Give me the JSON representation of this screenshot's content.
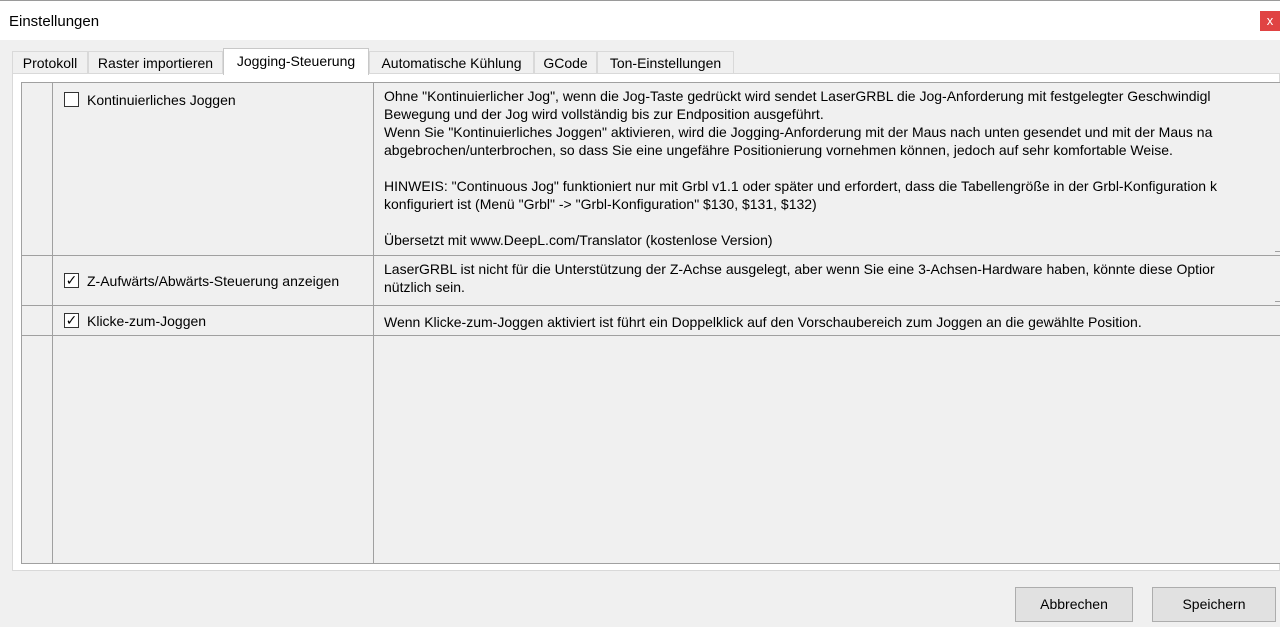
{
  "window": {
    "title": "Einstellungen",
    "close_glyph": "x"
  },
  "tabs": [
    {
      "label": "Protokoll"
    },
    {
      "label": "Raster importieren"
    },
    {
      "label": "Jogging-Steuerung",
      "active": true
    },
    {
      "label": "Automatische Kühlung"
    },
    {
      "label": "GCode"
    },
    {
      "label": "Ton-Einstellungen"
    }
  ],
  "rows": [
    {
      "option": "Kontinuierliches Joggen",
      "checked": false,
      "checkbox_glyph": "",
      "description": [
        "Ohne \"Kontinuierlicher Jog\", wenn die Jog-Taste gedrückt wird sendet LaserGRBL  die Jog-Anforderung mit festgelegter Geschwindigl",
        "Bewegung und der Jog wird vollständig bis zur Endposition ausgeführt.",
        "Wenn Sie \"Kontinuierliches Joggen\" aktivieren, wird die Jogging-Anforderung mit der Maus nach unten gesendet und mit der Maus na",
        "abgebrochen/unterbrochen, so dass Sie eine ungefähre Positionierung vornehmen können, jedoch auf sehr komfortable Weise.",
        "",
        "HINWEIS: \"Continuous Jog\" funktioniert nur mit Grbl v1.1 oder später und erfordert, dass die Tabellengröße in der Grbl-Konfiguration k",
        "konfiguriert ist (Menü \"Grbl\" -> \"Grbl-Konfiguration\" $130, $131, $132)",
        "",
        "Übersetzt mit www.DeepL.com/Translator (kostenlose Version)"
      ]
    },
    {
      "option": "Z-Aufwärts/Abwärts-Steuerung anzeigen",
      "checked": true,
      "checkbox_glyph": "✓",
      "description": [
        "LaserGRBL ist nicht für die Unterstützung der Z-Achse ausgelegt, aber wenn Sie eine 3-Achsen-Hardware haben, könnte diese Optior",
        "nützlich sein."
      ]
    },
    {
      "option": "Klicke-zum-Joggen",
      "checked": true,
      "checkbox_glyph": "✓",
      "description": [
        "Wenn Klicke-zum-Joggen aktiviert ist führt ein Doppelklick auf den Vorschaubereich zum Joggen an die gewählte Position."
      ]
    }
  ],
  "buttons": {
    "cancel": "Abbrechen",
    "save": "Speichern"
  }
}
